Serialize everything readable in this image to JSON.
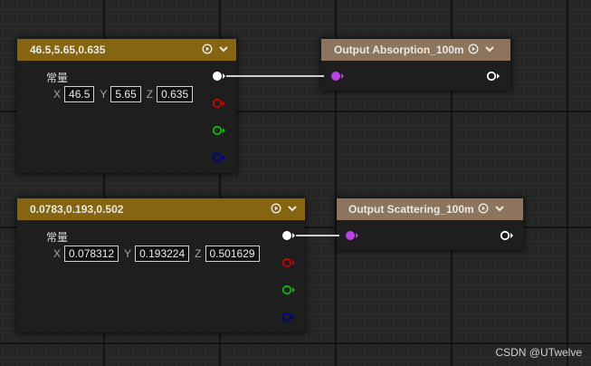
{
  "node1": {
    "title": "46.5,5.65,0.635",
    "label": "常量",
    "x_label": "X",
    "x_value": "46.5",
    "y_label": "Y",
    "y_value": "5.65",
    "z_label": "Z",
    "z_value": "0.635"
  },
  "node2": {
    "title": "Output Absorption_100m"
  },
  "node3": {
    "title": "0.0783,0.193,0.502",
    "label": "常量",
    "x_label": "X",
    "x_value": "0.078312",
    "y_label": "Y",
    "y_value": "0.193224",
    "z_label": "Z",
    "z_value": "0.501629"
  },
  "node4": {
    "title": "Output Scattering_100m"
  },
  "watermark": "CSDN @UTwelve",
  "colors": {
    "const_header": "#85650f",
    "output_header": "#8c755c",
    "pin_white": "#ffffff",
    "pin_red": "#d00000",
    "pin_green": "#00c000",
    "pin_blue": "#00008f",
    "pin_magenta": "#c040e8"
  },
  "icons": {
    "header_play": "play-circle-icon",
    "header_collapse": "chevron-down-icon"
  }
}
